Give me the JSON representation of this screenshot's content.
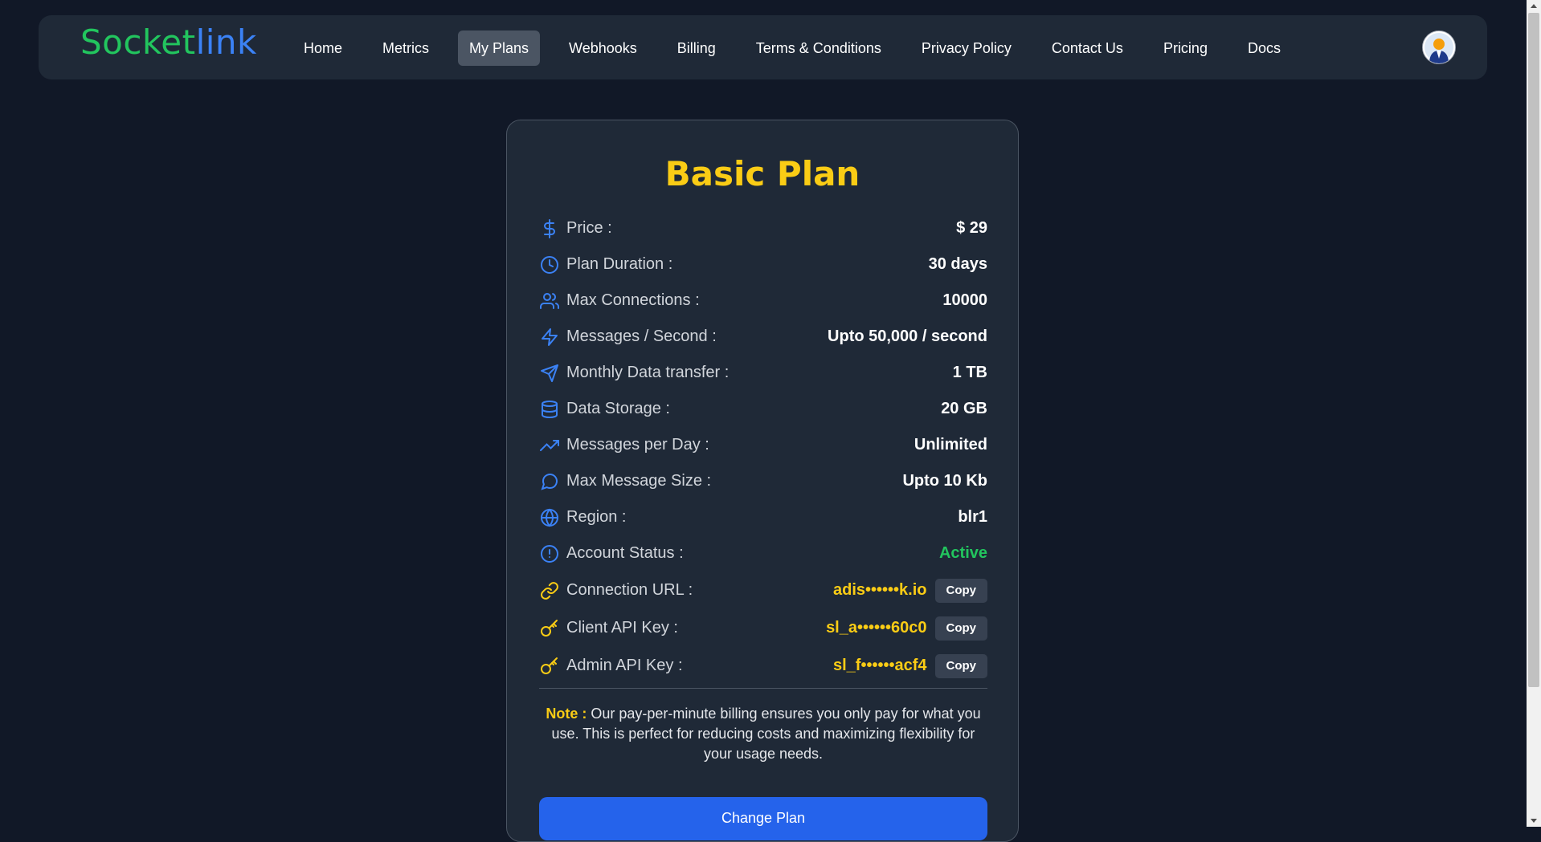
{
  "brand": {
    "logo_part1": "So",
    "logo_part2": "cket",
    "logo_part3": "link"
  },
  "nav": {
    "items": [
      {
        "label": "Home"
      },
      {
        "label": "Metrics"
      },
      {
        "label": "My Plans",
        "active": true
      },
      {
        "label": "Webhooks"
      },
      {
        "label": "Billing"
      },
      {
        "label": "Terms & Conditions"
      },
      {
        "label": "Privacy Policy"
      },
      {
        "label": "Contact Us"
      },
      {
        "label": "Pricing"
      },
      {
        "label": "Docs"
      }
    ]
  },
  "plan": {
    "title": "Basic Plan",
    "rows": [
      {
        "icon": "dollar-icon",
        "label": "Price :",
        "value": "$ 29"
      },
      {
        "icon": "clock-icon",
        "label": "Plan Duration :",
        "value": "30 days"
      },
      {
        "icon": "users-icon",
        "label": "Max Connections :",
        "value": "10000"
      },
      {
        "icon": "bolt-icon",
        "label": "Messages / Second :",
        "value": "Upto 50,000 / second"
      },
      {
        "icon": "send-icon",
        "label": "Monthly Data transfer :",
        "value": "1 TB"
      },
      {
        "icon": "database-icon",
        "label": "Data Storage :",
        "value": "20 GB"
      },
      {
        "icon": "trending-up-icon",
        "label": "Messages per Day :",
        "value": "Unlimited"
      },
      {
        "icon": "message-circle-icon",
        "label": "Max Message Size :",
        "value": "Upto 10 Kb"
      },
      {
        "icon": "globe-icon",
        "label": "Region :",
        "value": "blr1"
      },
      {
        "icon": "alert-circle-icon",
        "label": "Account Status :",
        "value": "Active"
      }
    ],
    "secrets": [
      {
        "icon": "link-icon",
        "label": "Connection URL :",
        "value": "adis••••••k.io",
        "button": "Copy"
      },
      {
        "icon": "key-icon",
        "label": "Client API Key :",
        "value": "sl_a••••••60c0",
        "button": "Copy"
      },
      {
        "icon": "key-icon",
        "label": "Admin API Key :",
        "value": "sl_f••••••acf4",
        "button": "Copy"
      }
    ],
    "note_label": "Note :",
    "note_text": " Our pay-per-minute billing ensures you only pay for what you use. This is perfect for reducing costs and maximizing flexibility for your usage needs.",
    "change_plan_label": "Change Plan"
  },
  "colors": {
    "accent": "#facc15",
    "primary": "#2563eb",
    "success": "#22c55e",
    "icon_blue": "#3b82f6"
  }
}
